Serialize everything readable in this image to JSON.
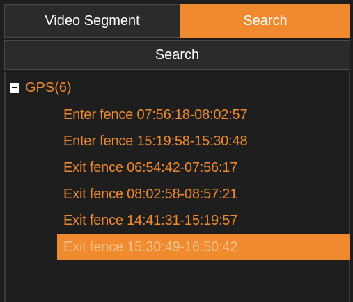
{
  "tabs": [
    {
      "label": "Video Segment",
      "active": false
    },
    {
      "label": "Search",
      "active": true
    }
  ],
  "search_button": {
    "label": "Search"
  },
  "tree": {
    "group": {
      "label": "GPS(6)",
      "expanded": true
    },
    "items": [
      {
        "label": "Enter fence 07:56:18-08:02:57",
        "selected": false
      },
      {
        "label": "Enter fence 15:19:58-15:30:48",
        "selected": false
      },
      {
        "label": "Exit fence 06:54:42-07:56:17",
        "selected": false
      },
      {
        "label": "Exit fence 08:02:58-08:57:21",
        "selected": false
      },
      {
        "label": "Exit fence 14:41:31-15:19:57",
        "selected": false
      },
      {
        "label": "Exit fence 15:30:49-16:50:42",
        "selected": true
      }
    ]
  },
  "colors": {
    "accent": "#ef8a2e",
    "background": "#1e1e1e",
    "selected_text": "#f6bf8a"
  }
}
